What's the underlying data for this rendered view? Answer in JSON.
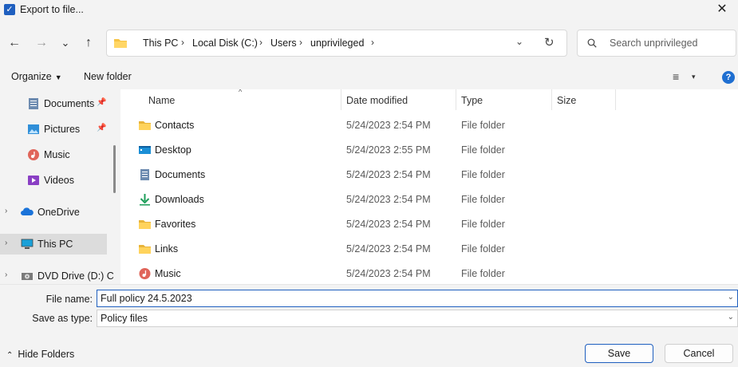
{
  "window": {
    "title": "Export to file...",
    "close": "✕"
  },
  "nav": {
    "back": "←",
    "forward": "→",
    "recent": "⌄",
    "up": "↑"
  },
  "address": {
    "crumbs": [
      "This PC",
      "Local Disk (C:)",
      "Users",
      "unprivileged"
    ],
    "separator": "›",
    "dropdown": "⌄",
    "refresh": "↻"
  },
  "search": {
    "placeholder": "Search unprivileged"
  },
  "toolbar": {
    "organize": "Organize",
    "new_folder": "New folder",
    "view_icon": "≡",
    "view_caret": "▾",
    "help": "?"
  },
  "sidebar": {
    "items": [
      {
        "label": "Documents",
        "icon": "documents-icon",
        "pinned": true
      },
      {
        "label": "Pictures",
        "icon": "pictures-icon",
        "pinned": true
      },
      {
        "label": "Music",
        "icon": "music-icon"
      },
      {
        "label": "Videos",
        "icon": "videos-icon"
      },
      {
        "label": "OneDrive",
        "icon": "onedrive-icon"
      },
      {
        "label": "This PC",
        "icon": "this-pc-icon"
      },
      {
        "label": "DVD Drive (D:) C",
        "icon": "dvd-drive-icon"
      }
    ],
    "pin": "📌"
  },
  "columns": {
    "name": "Name",
    "date": "Date modified",
    "type": "Type",
    "size": "Size",
    "sort_arrow": "^"
  },
  "files": [
    {
      "name": "Contacts",
      "date": "5/24/2023 2:54 PM",
      "type": "File folder",
      "icon": "folder-icon"
    },
    {
      "name": "Desktop",
      "date": "5/24/2023 2:55 PM",
      "type": "File folder",
      "icon": "desktop-icon"
    },
    {
      "name": "Documents",
      "date": "5/24/2023 2:54 PM",
      "type": "File folder",
      "icon": "documents-icon"
    },
    {
      "name": "Downloads",
      "date": "5/24/2023 2:54 PM",
      "type": "File folder",
      "icon": "downloads-icon"
    },
    {
      "name": "Favorites",
      "date": "5/24/2023 2:54 PM",
      "type": "File folder",
      "icon": "folder-icon"
    },
    {
      "name": "Links",
      "date": "5/24/2023 2:54 PM",
      "type": "File folder",
      "icon": "folder-icon"
    },
    {
      "name": "Music",
      "date": "5/24/2023 2:54 PM",
      "type": "File folder",
      "icon": "music-icon"
    }
  ],
  "form": {
    "file_name_label": "File name:",
    "file_name_value": "Full policy 24.5.2023",
    "save_type_label": "Save as type:",
    "save_type_value": "Policy files",
    "caret": "⌄"
  },
  "footer": {
    "hide_folders": "Hide Folders",
    "save": "Save",
    "cancel": "Cancel"
  },
  "colors": {
    "accent": "#1f5fbf",
    "folder": "#f6c344"
  }
}
